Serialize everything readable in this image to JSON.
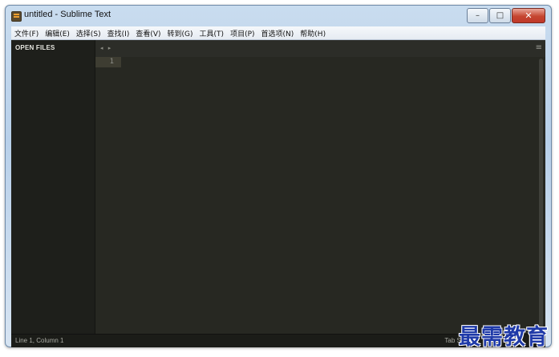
{
  "window": {
    "title": "untitled - Sublime Text",
    "buttons": {
      "minimize": "–",
      "maximize": "□",
      "close": "✕"
    }
  },
  "menu": [
    "文件(F)",
    "编辑(E)",
    "选择(S)",
    "查找(I)",
    "查看(V)",
    "转到(G)",
    "工具(T)",
    "项目(P)",
    "首选项(N)",
    "帮助(H)"
  ],
  "sidebar": {
    "title": "OPEN FILES"
  },
  "tabbar": {
    "arrows": "◂ ▸",
    "menu_icon": "≡"
  },
  "editor": {
    "line_number": "1"
  },
  "statusbar": {
    "position": "Line 1, Column 1",
    "right": "Tab Size: 4"
  },
  "watermark": "最需教育",
  "colors": {
    "editor_bg": "#272822",
    "sidebar_bg": "#1e1f1b",
    "watermark": "#1f3aa8"
  }
}
